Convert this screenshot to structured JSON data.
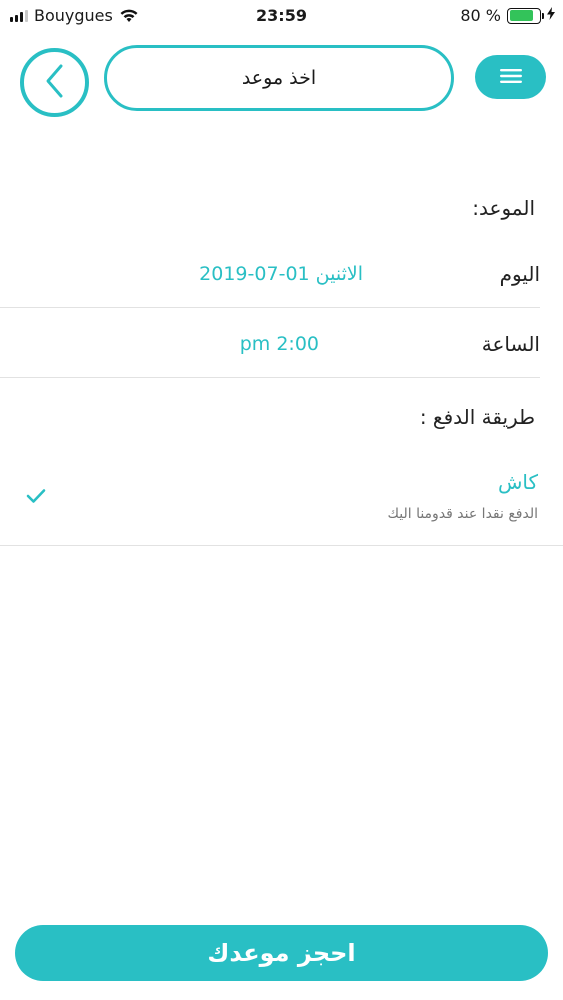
{
  "status_bar": {
    "carrier": "Bouygues",
    "time": "23:59",
    "battery_percent": "80 %",
    "battery_level": 0.8,
    "charging_icon": "bolt-icon"
  },
  "header": {
    "title": "اخذ موعد",
    "back_icon": "chevron-left-icon",
    "menu_icon": "hamburger-menu-icon"
  },
  "appointment": {
    "section_label": "الموعد:",
    "day_label": "اليوم",
    "day_value": "الاثنين 01-07-2019",
    "time_label": "الساعة",
    "time_value": "2:00 pm"
  },
  "payment": {
    "section_label": "طريقة الدفع :",
    "method_title": "كاش",
    "method_desc": "الدفع نقدا عند قدومنا اليك",
    "selected_icon": "checkmark-icon"
  },
  "footer": {
    "book_label": "احجز موعدك"
  },
  "colors": {
    "accent": "#29bfc4",
    "battery": "#33c35a"
  }
}
